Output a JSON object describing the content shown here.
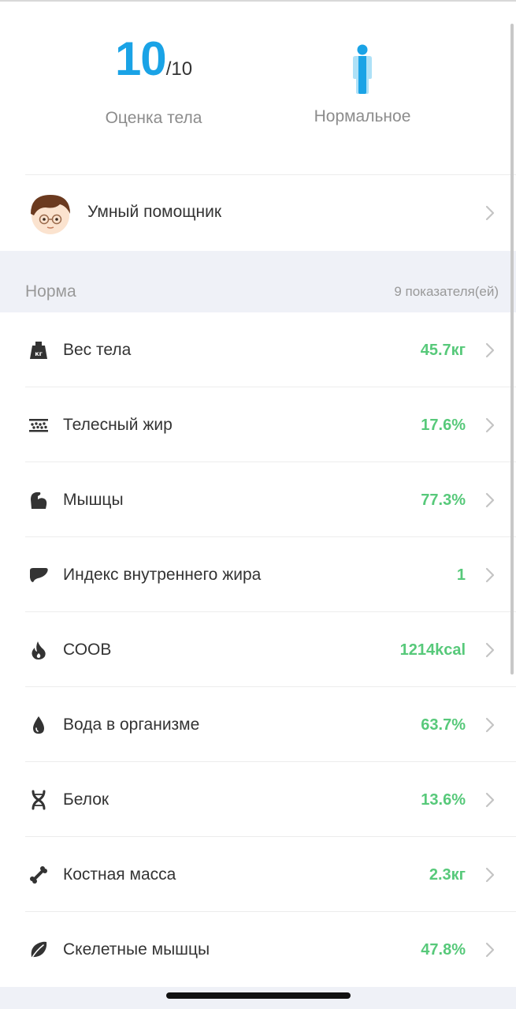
{
  "summary": {
    "score": "10",
    "score_max": "/10",
    "score_label": "Оценка тела",
    "body_type_label": "Нормальное",
    "body_icon": "body-figure-icon"
  },
  "assistant": {
    "label": "Умный помощник",
    "avatar_icon": "assistant-avatar"
  },
  "section": {
    "title": "Норма",
    "count": "9 показателя(ей)"
  },
  "metrics": [
    {
      "label": "Вес тела",
      "value": "45.7кг",
      "icon": "weight-icon"
    },
    {
      "label": "Телесный жир",
      "value": "17.6%",
      "icon": "fat-layer-icon"
    },
    {
      "label": "Мышцы",
      "value": "77.3%",
      "icon": "muscle-arm-icon"
    },
    {
      "label": "Индекс внутреннего жира",
      "value": "1",
      "icon": "liver-icon"
    },
    {
      "label": "СООВ",
      "value": "1214kcal",
      "icon": "flame-icon"
    },
    {
      "label": "Вода в организме",
      "value": "63.7%",
      "icon": "water-drop-icon"
    },
    {
      "label": "Белок",
      "value": "13.6%",
      "icon": "dna-icon"
    },
    {
      "label": "Костная масса",
      "value": "2.3кг",
      "icon": "bone-icon"
    },
    {
      "label": "Скелетные мышцы",
      "value": "47.8%",
      "icon": "leaf-icon"
    }
  ],
  "colors": {
    "accent_blue": "#1aa3e6",
    "value_green": "#57c97a",
    "section_bg": "#eff1f7"
  }
}
